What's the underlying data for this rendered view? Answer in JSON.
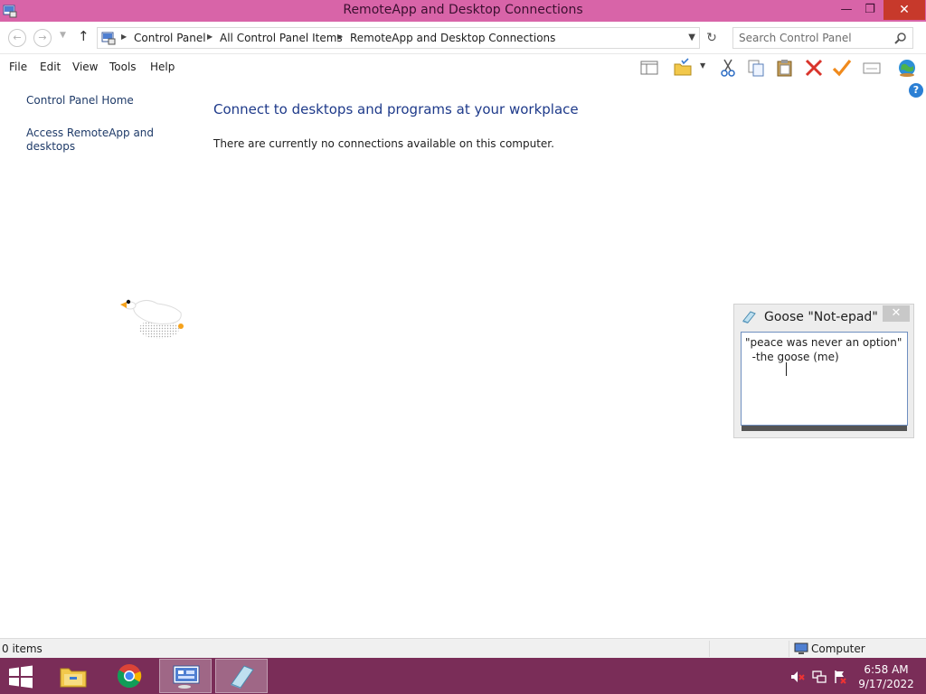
{
  "window": {
    "title": "RemoteApp and Desktop Connections",
    "minimize_glyph": "—",
    "maximize_glyph": "❐",
    "close_glyph": "✕"
  },
  "address": {
    "breadcrumbs": [
      "Control Panel",
      "All Control Panel Items",
      "RemoteApp and Desktop Connections"
    ],
    "search_placeholder": "Search Control Panel"
  },
  "menu": {
    "items": [
      "File",
      "Edit",
      "View",
      "Tools",
      "Help"
    ]
  },
  "toolbar": {
    "icons": [
      "pane-icon",
      "folder-properties-icon",
      "cut-icon",
      "copy-icon",
      "paste-icon",
      "delete-icon",
      "checkmark-icon",
      "properties-icon",
      "globe-icon"
    ]
  },
  "sidebar": {
    "links": [
      "Control Panel Home",
      "Access RemoteApp and desktops"
    ]
  },
  "main": {
    "heading": "Connect to desktops and programs at your workplace",
    "message": "There are currently no connections available on this computer."
  },
  "notepad": {
    "title": "Goose \"Not-epad\"",
    "close_glyph": "✕",
    "text": "\"peace was never an option\"\n  -the goose (me)"
  },
  "statusbar": {
    "item_count": "0 items",
    "zone": "Computer"
  },
  "taskbar": {
    "apps": [
      "file-explorer",
      "chrome",
      "control-panel",
      "notepad"
    ],
    "time": "6:58 AM",
    "date": "9/17/2022"
  },
  "colors": {
    "titlebar": "#d864a8",
    "taskbar": "#7a2d58",
    "close_button": "#c7392b",
    "link": "#1e3a68",
    "heading": "#1e3a8a"
  }
}
